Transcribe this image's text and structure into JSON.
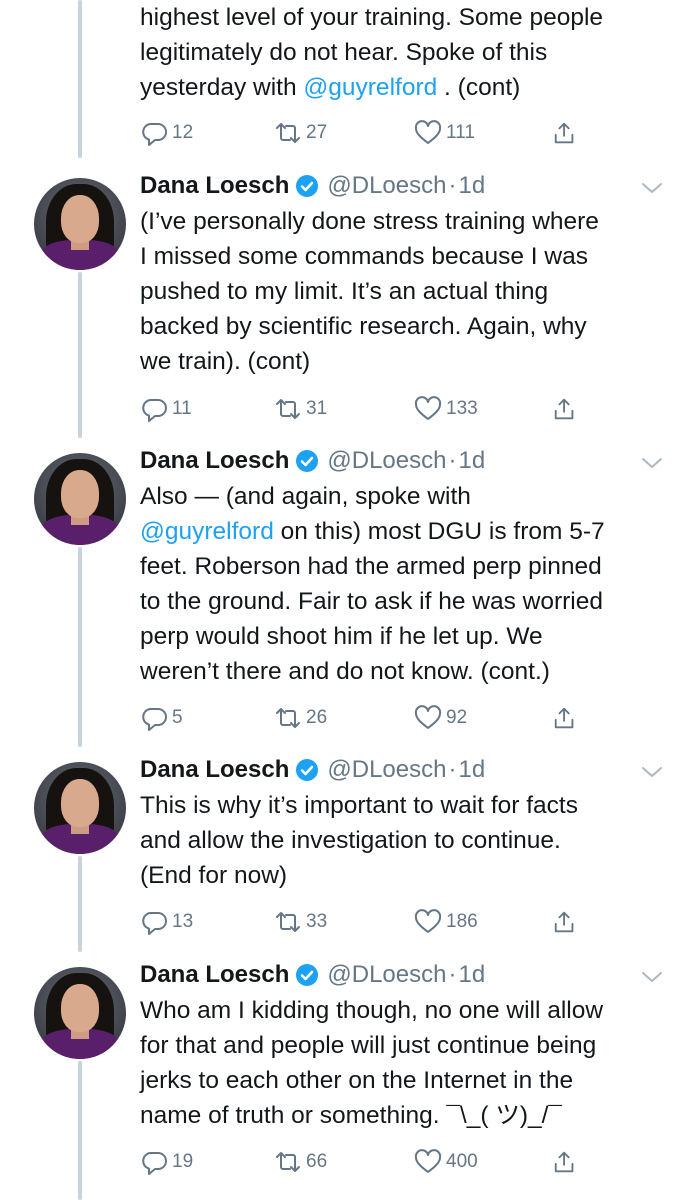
{
  "colors": {
    "link": "#1da1f2",
    "muted": "#657786",
    "text": "#14171a",
    "verified": "#1da1f2",
    "thread_line": "#c9d3dc"
  },
  "icons": {
    "reply": "reply-icon",
    "retweet": "retweet-icon",
    "like": "heart-icon",
    "share": "share-icon",
    "verified": "verified-badge-icon",
    "more": "chevron-down-icon"
  },
  "tweets": [
    {
      "partial": true,
      "lines": [
        [
          {
            "t": "highest level of your training. Some people"
          }
        ],
        [
          {
            "t": "legitimately do not hear. Spoke of this"
          }
        ],
        [
          {
            "t": "yesterday with "
          },
          {
            "t": "@guyrelford",
            "mention": true
          },
          {
            "t": " . (cont)"
          }
        ]
      ],
      "replies": "12",
      "retweets": "27",
      "likes": "111"
    },
    {
      "name": "Dana Loesch",
      "handle": "@DLoesch",
      "time": "1d",
      "lines": [
        [
          {
            "t": "(I’ve personally done stress training where"
          }
        ],
        [
          {
            "t": "I missed some commands because I was"
          }
        ],
        [
          {
            "t": "pushed to my limit. It’s an actual thing"
          }
        ],
        [
          {
            "t": "backed by scientific research. Again, why"
          }
        ],
        [
          {
            "t": "we train).  (cont)"
          }
        ]
      ],
      "replies": "11",
      "retweets": "31",
      "likes": "133"
    },
    {
      "name": "Dana Loesch",
      "handle": "@DLoesch",
      "time": "1d",
      "lines": [
        [
          {
            "t": "Also — (and again, spoke with"
          }
        ],
        [
          {
            "t": "@guyrelford",
            "mention": true
          },
          {
            "t": " on this) most DGU is from 5-7"
          }
        ],
        [
          {
            "t": "feet. Roberson had the armed perp pinned"
          }
        ],
        [
          {
            "t": "to the ground. Fair to ask if he was worried"
          }
        ],
        [
          {
            "t": "perp would shoot him if he let up. We"
          }
        ],
        [
          {
            "t": "weren’t there and do not know. (cont.)"
          }
        ]
      ],
      "replies": "5",
      "retweets": "26",
      "likes": "92"
    },
    {
      "name": "Dana Loesch",
      "handle": "@DLoesch",
      "time": "1d",
      "lines": [
        [
          {
            "t": "This is why it’s important to wait for facts"
          }
        ],
        [
          {
            "t": "and allow the investigation to continue."
          }
        ],
        [
          {
            "t": "(End for now)"
          }
        ]
      ],
      "replies": "13",
      "retweets": "33",
      "likes": "186"
    },
    {
      "name": "Dana Loesch",
      "handle": "@DLoesch",
      "time": "1d",
      "lines": [
        [
          {
            "t": "Who am I kidding though, no one will allow"
          }
        ],
        [
          {
            "t": "for that and people will just continue being"
          }
        ],
        [
          {
            "t": "jerks to each other on the Internet in the"
          }
        ],
        [
          {
            "t": "name of truth or something. ¯\\_( ツ)_/¯"
          }
        ]
      ],
      "replies": "19",
      "retweets": "66",
      "likes": "400"
    }
  ]
}
